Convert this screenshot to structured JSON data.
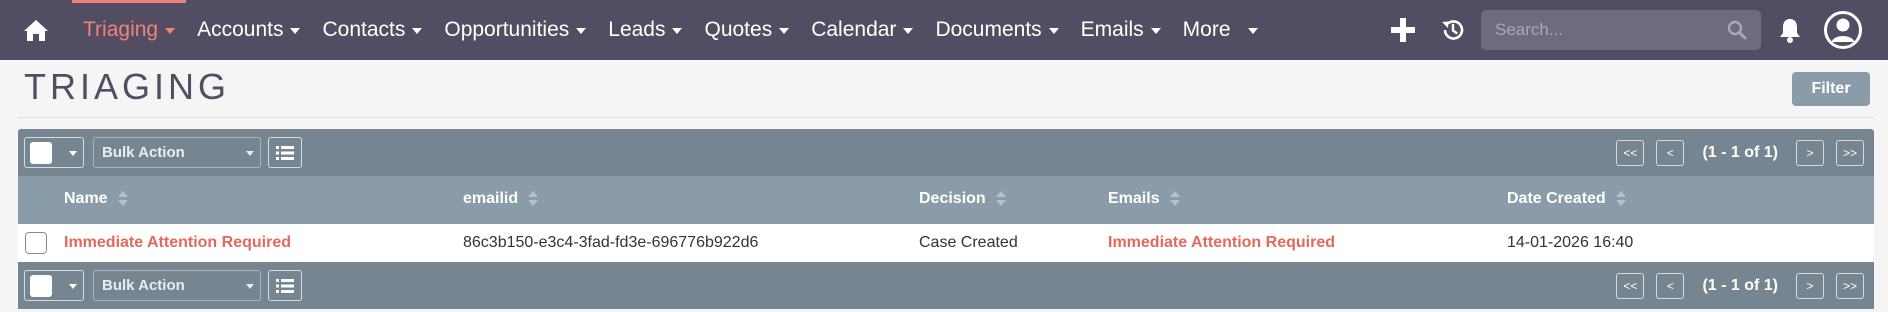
{
  "nav": {
    "items": [
      {
        "label": "Triaging",
        "active": true
      },
      {
        "label": "Accounts"
      },
      {
        "label": "Contacts"
      },
      {
        "label": "Opportunities"
      },
      {
        "label": "Leads"
      },
      {
        "label": "Quotes"
      },
      {
        "label": "Calendar"
      },
      {
        "label": "Documents"
      },
      {
        "label": "Emails"
      },
      {
        "label": "More"
      }
    ],
    "search_placeholder": "Search...",
    "icons": [
      "home-icon",
      "plus-icon",
      "history-icon",
      "search-icon",
      "bell-icon",
      "user-icon"
    ]
  },
  "page": {
    "title": "TRIAGING",
    "filter_label": "Filter"
  },
  "toolbar": {
    "bulk_action_label": "Bulk Action",
    "first_label": "<<",
    "prev_label": "<",
    "pagination_info": "(1 - 1 of 1)",
    "next_label": ">",
    "last_label": ">>"
  },
  "table": {
    "columns": [
      "Name",
      "emailid",
      "Decision",
      "Emails",
      "Date Created"
    ],
    "rows": [
      {
        "name": "Immediate Attention Required",
        "emailid": "86c3b150-e3c4-3fad-fd3e-696776b922d6",
        "decision": "Case Created",
        "emails": "Immediate Attention Required",
        "date_created": "14-01-2026 16:40"
      }
    ]
  },
  "colors": {
    "nav_bg": "#534d64",
    "accent": "#f08377",
    "toolbar_bg": "#778591",
    "header_bg": "#8b9ca9",
    "link": "#e4685c"
  }
}
